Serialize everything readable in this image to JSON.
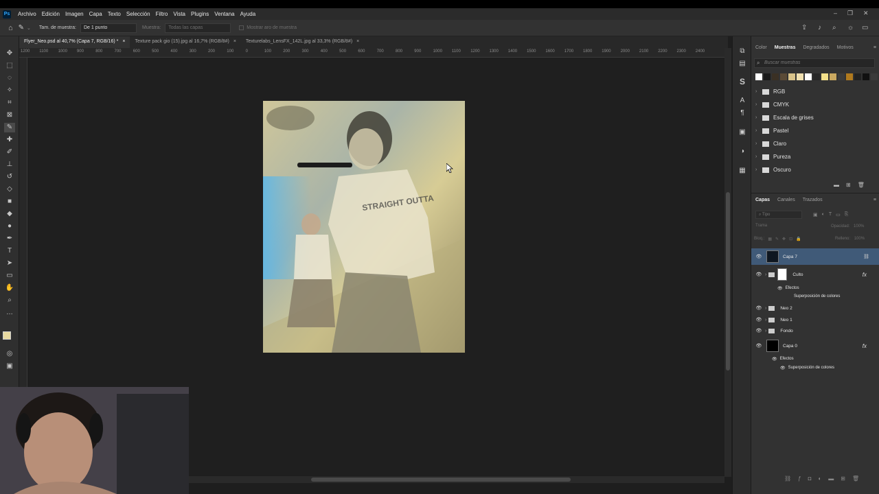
{
  "app": {
    "logo": "Ps",
    "menu": [
      "Archivo",
      "Edición",
      "Imagen",
      "Capa",
      "Texto",
      "Selección",
      "Filtro",
      "Vista",
      "Plugins",
      "Ventana",
      "Ayuda"
    ]
  },
  "window_controls": {
    "minimize": "–",
    "restore": "❐",
    "close": "✕"
  },
  "options": {
    "sample_size_label": "Tam. de muestra:",
    "sample_size_value": "De 1 punto",
    "sample_label": "Muestra:",
    "sample_value": "Todas las capas",
    "show_ring_label": "Mostrar aro de muestra"
  },
  "tabs": [
    {
      "label": "Flyer_Neo.psd al 40,7% (Capa 7, RGB/16) *",
      "close": "×"
    },
    {
      "label": "Texture pack gio (15).jpg al 16,7% (RGB/8#)",
      "close": "×"
    },
    {
      "label": "Texturelabs_LensFX_142L.jpg al 33,3% (RGB/8#)",
      "close": "×"
    }
  ],
  "ruler_ticks": [
    "1200",
    "1100",
    "1000",
    "900",
    "800",
    "700",
    "600",
    "500",
    "400",
    "300",
    "200",
    "100",
    "0",
    "100",
    "200",
    "300",
    "400",
    "500",
    "600",
    "700",
    "800",
    "900",
    "1000",
    "1100",
    "1200",
    "1300",
    "1400",
    "1500",
    "1600",
    "1700",
    "1800",
    "1900",
    "2000",
    "2100",
    "2200",
    "2300",
    "2400"
  ],
  "color_panel": {
    "tabs": [
      "Color",
      "Muestras",
      "Degradados",
      "Motivos"
    ],
    "active_tab": "Muestras",
    "search_placeholder": "Buscar muestras",
    "swatches": [
      "#ffffff",
      "#1a1a1a",
      "#3a3024",
      "#5a4a36",
      "#d9c38a",
      "#f0e0b0",
      "#ffffff",
      "#262626",
      "#f3e08a",
      "#c9a860",
      "#3c3c3c",
      "#b07a1e",
      "#222222",
      "#111111",
      "#3a3a3a"
    ],
    "groups": [
      "RGB",
      "CMYK",
      "Escala de grises",
      "Pastel",
      "Claro",
      "Pureza",
      "Oscuro"
    ]
  },
  "layers_panel": {
    "tabs": [
      "Capas",
      "Canales",
      "Trazados"
    ],
    "active_tab": "Capas",
    "kind_placeholder": "Tipo",
    "blend_mode": "Trama",
    "opacity_label": "Opacidad:",
    "opacity_value": "100%",
    "lock_label": "Bloq.:",
    "fill_label": "Relleno:",
    "fill_value": "100%",
    "layers": [
      {
        "name": "Capa 7"
      },
      {
        "name": "Culto",
        "fx": "fx"
      },
      {
        "name": "Efectos"
      },
      {
        "name": "Superposición de colores"
      },
      {
        "name": "Neo 2"
      },
      {
        "name": "Neo 1"
      },
      {
        "name": "Fondo"
      },
      {
        "name": "Capa 0",
        "fx": "fx"
      },
      {
        "name": "Efectos"
      },
      {
        "name": "Superposición de colores"
      }
    ]
  },
  "icons": [
    "home-icon",
    "eyedropper-icon",
    "share-icon",
    "bell-icon",
    "search-icon",
    "lightbulb-icon",
    "workspace-icon"
  ]
}
